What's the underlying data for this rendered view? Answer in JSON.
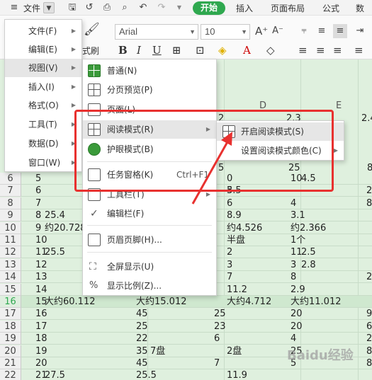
{
  "topbar": {
    "file_label": "文件",
    "tabs": [
      "开始",
      "插入",
      "页面布局",
      "公式",
      "数据"
    ]
  },
  "toolbar": {
    "font_name": "Arial",
    "font_size": "10",
    "format_painter_label": "式刷"
  },
  "file_menu": {
    "items": [
      {
        "label": "文件(F)"
      },
      {
        "label": "编辑(E)"
      },
      {
        "label": "视图(V)"
      },
      {
        "label": "插入(I)"
      },
      {
        "label": "格式(O)"
      },
      {
        "label": "工具(T)"
      },
      {
        "label": "数据(D)"
      },
      {
        "label": "窗口(W)"
      }
    ]
  },
  "view_menu": {
    "items": [
      {
        "label": "普通(N)"
      },
      {
        "label": "分页预览(P)"
      },
      {
        "label": "页面(L)"
      },
      {
        "label": "阅读模式(R)"
      },
      {
        "label": "护眼模式(B)"
      },
      {
        "label": "任务窗格(K)",
        "shortcut": "Ctrl+F1"
      },
      {
        "label": "工具栏(T)"
      },
      {
        "label": "编辑栏(F)"
      },
      {
        "label": "页眉页脚(H)..."
      },
      {
        "label": "全屏显示(U)"
      },
      {
        "label": "显示比例(Z)..."
      }
    ]
  },
  "read_menu": {
    "items": [
      {
        "label": "开启阅读模式(S)"
      },
      {
        "label": "设置阅读模式颜色(C)"
      }
    ]
  },
  "sheet": {
    "columns": [
      "D",
      "E"
    ],
    "rows": [
      {
        "n": "6",
        "a": "5",
        "c": "0",
        "d": "10",
        "d2": "4.5",
        "e": ""
      },
      {
        "n": "7",
        "a": "6",
        "c": "5",
        "c2": "3.5",
        "d": "",
        "e": "2"
      },
      {
        "n": "8",
        "a": "7",
        "c": "6",
        "d": "4",
        "e": "8"
      },
      {
        "n": "9",
        "a": "8",
        "a2": "25.4",
        "c": "8.9",
        "d": "3.1",
        "e": ""
      },
      {
        "n": "10",
        "a": "9",
        "a2": "约20.728",
        "c": "约4.526",
        "d": "约2.366",
        "e": ""
      },
      {
        "n": "11",
        "a": "10",
        "c": "半盘",
        "d": "1个",
        "e": ""
      },
      {
        "n": "12",
        "a": "11",
        "a2": "25.5",
        "c": "2",
        "d": "11",
        "d2": "2.5",
        "e": ""
      },
      {
        "n": "13",
        "a": "12",
        "c": "3",
        "d": "3",
        "d2": "2.8",
        "e": ""
      },
      {
        "n": "14",
        "a": "13",
        "c": "7",
        "d": "8",
        "e": "2"
      },
      {
        "n": "15",
        "a": "14",
        "c": "11.2",
        "d": "2.9",
        "e": ""
      },
      {
        "n": "16",
        "a": "15",
        "a2": "大约60.112",
        "b": "大约15.012",
        "c": "大约4.712",
        "d": "大约11.012",
        "e": ""
      },
      {
        "n": "17",
        "a": "16",
        "b": "45",
        "b2": "25",
        "d": "20",
        "e": "9"
      },
      {
        "n": "18",
        "a": "17",
        "b": "25",
        "b2": "23",
        "d": "20",
        "e": "6"
      },
      {
        "n": "19",
        "a": "18",
        "b": "22",
        "b2": "6",
        "d": "4",
        "e": "2"
      },
      {
        "n": "20",
        "a": "19",
        "b": "35",
        "b3": "7盘",
        "c": "2盘",
        "d": "25",
        "e": "8"
      },
      {
        "n": "21",
        "a": "20",
        "b": "45",
        "b2": "7",
        "d": "5",
        "e": "8"
      },
      {
        "n": "22",
        "a": "21",
        "a2": "27.5",
        "b": "25.5",
        "c": "11.9",
        "e": ""
      }
    ],
    "row2_values": {
      "c": "2",
      "d": "2.3",
      "e": "2.4"
    },
    "row5_values": {
      "c": "5",
      "d": "25",
      "e": "8"
    },
    "watermark": "Baidu经验"
  },
  "colors": {
    "accent": "#2fa84f",
    "sheet_bg": "#dff0de",
    "highlight_box": "#e8312f"
  }
}
